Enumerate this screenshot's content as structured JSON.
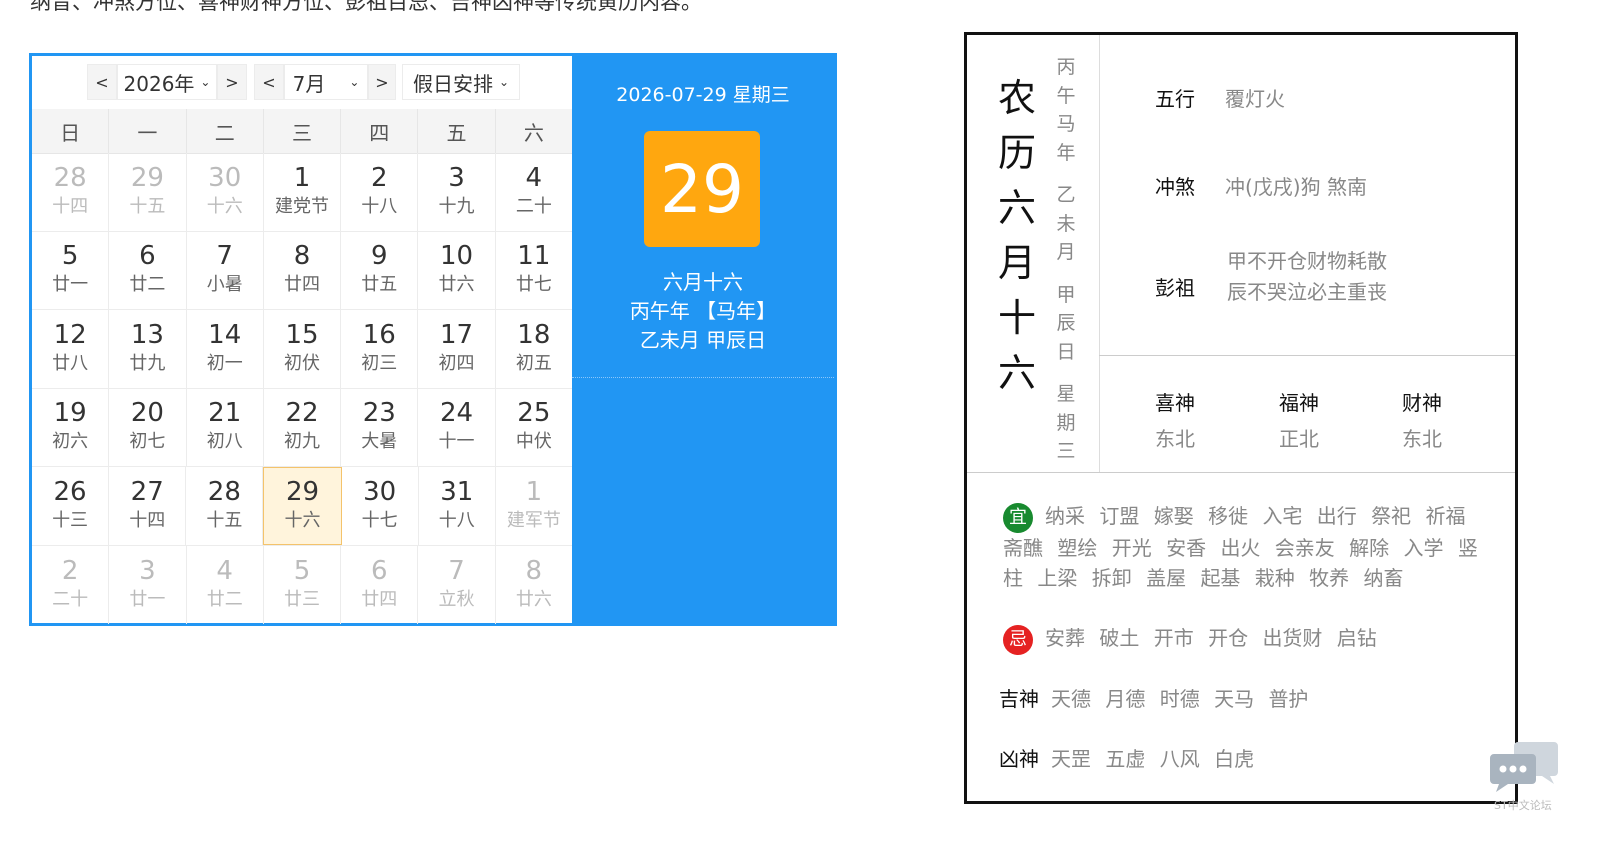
{
  "intro_text": "纳音、冲煞方位、喜神财神方位、彭祖百忌、吉神凶神等传统黄历内容。",
  "toolbar": {
    "prev_year": "<",
    "year": "2026年",
    "next_year": ">",
    "prev_month": "<",
    "month": "7月",
    "next_month": ">",
    "holiday": "假日安排"
  },
  "weekdays": [
    "日",
    "一",
    "二",
    "三",
    "四",
    "五",
    "六"
  ],
  "weeks": [
    [
      {
        "d": "28",
        "l": "十四",
        "other": true
      },
      {
        "d": "29",
        "l": "十五",
        "other": true
      },
      {
        "d": "30",
        "l": "十六",
        "other": true
      },
      {
        "d": "1",
        "l": "建党节"
      },
      {
        "d": "2",
        "l": "十八"
      },
      {
        "d": "3",
        "l": "十九"
      },
      {
        "d": "4",
        "l": "二十"
      }
    ],
    [
      {
        "d": "5",
        "l": "廿一"
      },
      {
        "d": "6",
        "l": "廿二"
      },
      {
        "d": "7",
        "l": "小暑"
      },
      {
        "d": "8",
        "l": "廿四"
      },
      {
        "d": "9",
        "l": "廿五"
      },
      {
        "d": "10",
        "l": "廿六"
      },
      {
        "d": "11",
        "l": "廿七"
      }
    ],
    [
      {
        "d": "12",
        "l": "廿八"
      },
      {
        "d": "13",
        "l": "廿九"
      },
      {
        "d": "14",
        "l": "初一"
      },
      {
        "d": "15",
        "l": "初伏"
      },
      {
        "d": "16",
        "l": "初三"
      },
      {
        "d": "17",
        "l": "初四"
      },
      {
        "d": "18",
        "l": "初五"
      }
    ],
    [
      {
        "d": "19",
        "l": "初六"
      },
      {
        "d": "20",
        "l": "初七"
      },
      {
        "d": "21",
        "l": "初八"
      },
      {
        "d": "22",
        "l": "初九"
      },
      {
        "d": "23",
        "l": "大暑"
      },
      {
        "d": "24",
        "l": "十一"
      },
      {
        "d": "25",
        "l": "中伏"
      }
    ],
    [
      {
        "d": "26",
        "l": "十三"
      },
      {
        "d": "27",
        "l": "十四"
      },
      {
        "d": "28",
        "l": "十五"
      },
      {
        "d": "29",
        "l": "十六",
        "selected": true
      },
      {
        "d": "30",
        "l": "十七"
      },
      {
        "d": "31",
        "l": "十八"
      },
      {
        "d": "1",
        "l": "建军节",
        "other": true
      }
    ],
    [
      {
        "d": "2",
        "l": "二十",
        "other": true
      },
      {
        "d": "3",
        "l": "廿一",
        "other": true
      },
      {
        "d": "4",
        "l": "廿二",
        "other": true
      },
      {
        "d": "5",
        "l": "廿三",
        "other": true
      },
      {
        "d": "6",
        "l": "廿四",
        "other": true
      },
      {
        "d": "7",
        "l": "立秋",
        "other": true
      },
      {
        "d": "8",
        "l": "廿六",
        "other": true
      }
    ]
  ],
  "side": {
    "date_line": "2026-07-29 星期三",
    "big_day": "29",
    "lunar_date": "六月十六",
    "year_gz": "丙午年 【马年】",
    "month_day_gz": "乙未月 甲辰日"
  },
  "almanac": {
    "lunar_title": [
      "农",
      "历",
      "六",
      "月",
      "十",
      "六"
    ],
    "ganzhi": [
      [
        "丙",
        "午",
        "马",
        "年"
      ],
      [
        "乙",
        "未",
        "月"
      ],
      [
        "甲",
        "辰",
        "日"
      ],
      [
        "星",
        "期",
        "三"
      ]
    ],
    "wuxing_label": "五行",
    "wuxing_value": "覆灯火",
    "chongsha_label": "冲煞",
    "chongsha_value": "冲(戊戌)狗 煞南",
    "pengzu_label": "彭祖",
    "pengzu_line1": "甲不开仓财物耗散",
    "pengzu_line2": "辰不哭泣必主重丧",
    "xishen_label": "喜神",
    "xishen_value": "东北",
    "fushen_label": "福神",
    "fushen_value": "正北",
    "caishen_label": "财神",
    "caishen_value": "东北",
    "yi_badge": "宜",
    "yi_items": [
      "纳采",
      "订盟",
      "嫁娶",
      "移徙",
      "入宅",
      "出行",
      "祭祀",
      "祈福",
      "斋醮",
      "塑绘",
      "开光",
      "安香",
      "出火",
      "会亲友",
      "解除",
      "入学",
      "竖柱",
      "上梁",
      "拆卸",
      "盖屋",
      "起基",
      "栽种",
      "牧养",
      "纳畜"
    ],
    "ji_badge": "忌",
    "ji_items": [
      "安葬",
      "破土",
      "开市",
      "开仓",
      "出货财",
      "启钻"
    ],
    "jishen_label": "吉神",
    "jishen_items": [
      "天德",
      "月德",
      "时德",
      "天马",
      "普护"
    ],
    "xiongshen_label": "凶神",
    "xiongshen_items": [
      "天罡",
      "五虚",
      "八风",
      "白虎"
    ]
  },
  "watermark": "ST中文论坛"
}
